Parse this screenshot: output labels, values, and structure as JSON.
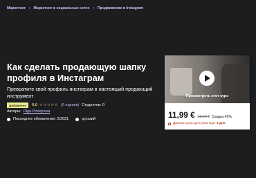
{
  "breadcrumb": [
    "Маркетинг",
    "Маркетинг в социальных сетях",
    "Продвижение в Instagram"
  ],
  "course": {
    "title": "Как сделать продающую шапку профиля в Инстаграм",
    "subtitle": "Превратите свой профиль инстаграм в настоящий продающий инструмент",
    "badge": "Добавлено",
    "rating": "0,0",
    "stars": "☆☆☆☆☆",
    "rating_count": "(0 оценок)",
    "students": "Студентов: 0",
    "authors_label": "Авторы:",
    "author": "Olga Prolejcova",
    "updated": "Последнее обновление: 2/2021",
    "language": "русский"
  },
  "sidebar": {
    "preview_label": "Просмотреть этот курс",
    "price": "11,99 €",
    "old_price": "19,99 €",
    "discount": "Скидка 40%",
    "timer_text": "Данная цена доступна ещё",
    "timer_value": "1 дня"
  },
  "colors": {
    "background": "#1c1d1f",
    "link": "#cec0fc",
    "star": "#f3ca8c",
    "badge": "#eceb98",
    "timer": "#b32d0f"
  }
}
